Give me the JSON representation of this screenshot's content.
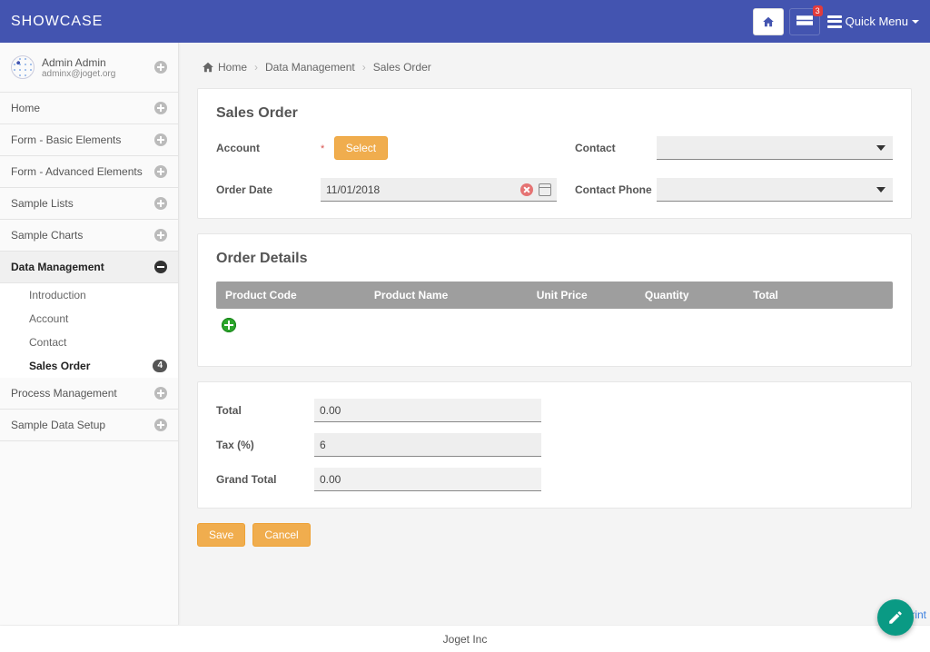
{
  "header": {
    "brand": "SHOWCASE",
    "notification_count": "3",
    "quick_menu_label": "Quick Menu"
  },
  "user": {
    "name": "Admin Admin",
    "email": "adminx@joget.org"
  },
  "sidebar": {
    "items": [
      {
        "label": "Home",
        "expandable": true,
        "active": false
      },
      {
        "label": "Form - Basic Elements",
        "expandable": true,
        "active": false
      },
      {
        "label": "Form - Advanced Elements",
        "expandable": true,
        "active": false
      },
      {
        "label": "Sample Lists",
        "expandable": true,
        "active": false
      },
      {
        "label": "Sample Charts",
        "expandable": true,
        "active": false
      },
      {
        "label": "Data Management",
        "expandable": true,
        "active": true
      },
      {
        "label": "Process Management",
        "expandable": true,
        "active": false
      },
      {
        "label": "Sample Data Setup",
        "expandable": true,
        "active": false
      }
    ],
    "data_management_children": [
      {
        "label": "Introduction"
      },
      {
        "label": "Account"
      },
      {
        "label": "Contact"
      },
      {
        "label": "Sales Order",
        "active": true,
        "count": "4"
      }
    ]
  },
  "breadcrumb": {
    "home": "Home",
    "sep": "›",
    "level1": "Data Management",
    "level2": "Sales Order"
  },
  "form": {
    "title": "Sales Order",
    "account_label": "Account",
    "account_select_btn": "Select",
    "contact_label": "Contact",
    "order_date_label": "Order Date",
    "order_date_value": "11/01/2018",
    "contact_phone_label": "Contact Phone"
  },
  "order_details": {
    "title": "Order Details",
    "columns": {
      "code": "Product Code",
      "name": "Product Name",
      "price": "Unit Price",
      "qty": "Quantity",
      "total": "Total"
    }
  },
  "totals": {
    "total_label": "Total",
    "total_value": "0.00",
    "tax_label": "Tax (%)",
    "tax_value": "6",
    "grand_label": "Grand Total",
    "grand_value": "0.00"
  },
  "actions": {
    "save": "Save",
    "cancel": "Cancel"
  },
  "print_label": "Print",
  "footer": "Joget Inc"
}
